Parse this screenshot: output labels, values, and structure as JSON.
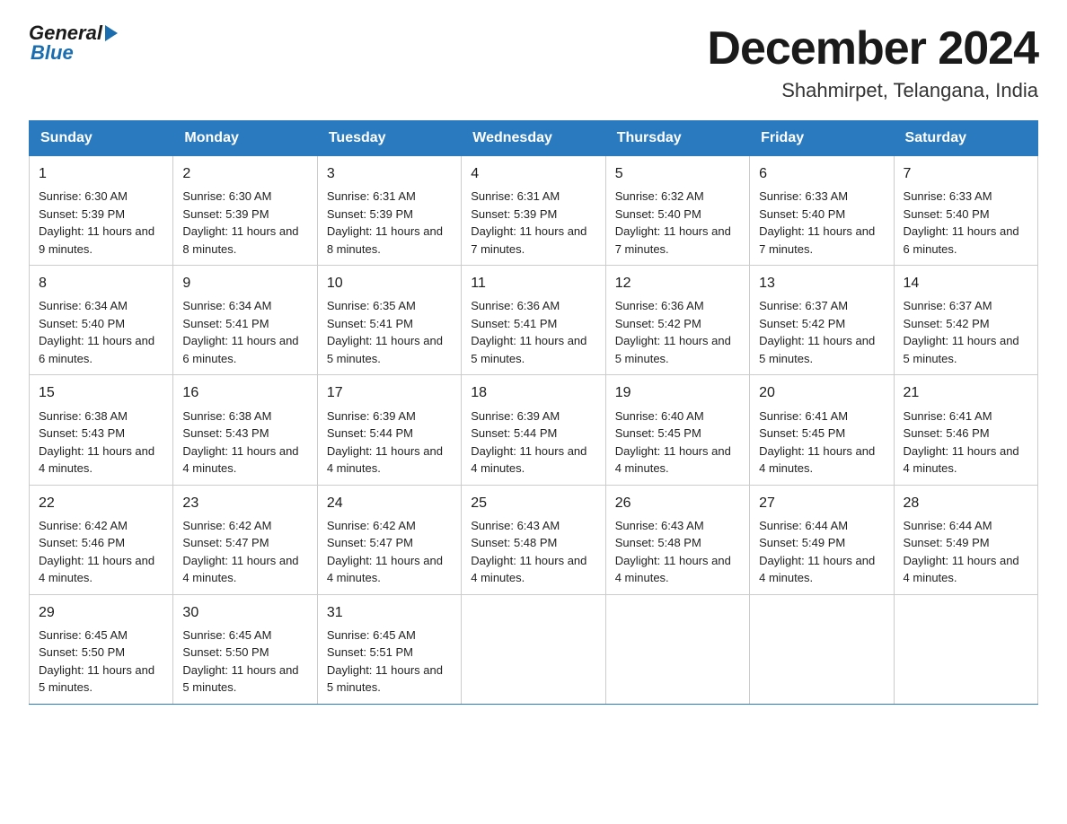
{
  "logo": {
    "general": "General",
    "blue": "Blue"
  },
  "title": "December 2024",
  "subtitle": "Shahmirpet, Telangana, India",
  "days_of_week": [
    "Sunday",
    "Monday",
    "Tuesday",
    "Wednesday",
    "Thursday",
    "Friday",
    "Saturday"
  ],
  "weeks": [
    [
      {
        "day": "1",
        "sunrise": "Sunrise: 6:30 AM",
        "sunset": "Sunset: 5:39 PM",
        "daylight": "Daylight: 11 hours and 9 minutes."
      },
      {
        "day": "2",
        "sunrise": "Sunrise: 6:30 AM",
        "sunset": "Sunset: 5:39 PM",
        "daylight": "Daylight: 11 hours and 8 minutes."
      },
      {
        "day": "3",
        "sunrise": "Sunrise: 6:31 AM",
        "sunset": "Sunset: 5:39 PM",
        "daylight": "Daylight: 11 hours and 8 minutes."
      },
      {
        "day": "4",
        "sunrise": "Sunrise: 6:31 AM",
        "sunset": "Sunset: 5:39 PM",
        "daylight": "Daylight: 11 hours and 7 minutes."
      },
      {
        "day": "5",
        "sunrise": "Sunrise: 6:32 AM",
        "sunset": "Sunset: 5:40 PM",
        "daylight": "Daylight: 11 hours and 7 minutes."
      },
      {
        "day": "6",
        "sunrise": "Sunrise: 6:33 AM",
        "sunset": "Sunset: 5:40 PM",
        "daylight": "Daylight: 11 hours and 7 minutes."
      },
      {
        "day": "7",
        "sunrise": "Sunrise: 6:33 AM",
        "sunset": "Sunset: 5:40 PM",
        "daylight": "Daylight: 11 hours and 6 minutes."
      }
    ],
    [
      {
        "day": "8",
        "sunrise": "Sunrise: 6:34 AM",
        "sunset": "Sunset: 5:40 PM",
        "daylight": "Daylight: 11 hours and 6 minutes."
      },
      {
        "day": "9",
        "sunrise": "Sunrise: 6:34 AM",
        "sunset": "Sunset: 5:41 PM",
        "daylight": "Daylight: 11 hours and 6 minutes."
      },
      {
        "day": "10",
        "sunrise": "Sunrise: 6:35 AM",
        "sunset": "Sunset: 5:41 PM",
        "daylight": "Daylight: 11 hours and 5 minutes."
      },
      {
        "day": "11",
        "sunrise": "Sunrise: 6:36 AM",
        "sunset": "Sunset: 5:41 PM",
        "daylight": "Daylight: 11 hours and 5 minutes."
      },
      {
        "day": "12",
        "sunrise": "Sunrise: 6:36 AM",
        "sunset": "Sunset: 5:42 PM",
        "daylight": "Daylight: 11 hours and 5 minutes."
      },
      {
        "day": "13",
        "sunrise": "Sunrise: 6:37 AM",
        "sunset": "Sunset: 5:42 PM",
        "daylight": "Daylight: 11 hours and 5 minutes."
      },
      {
        "day": "14",
        "sunrise": "Sunrise: 6:37 AM",
        "sunset": "Sunset: 5:42 PM",
        "daylight": "Daylight: 11 hours and 5 minutes."
      }
    ],
    [
      {
        "day": "15",
        "sunrise": "Sunrise: 6:38 AM",
        "sunset": "Sunset: 5:43 PM",
        "daylight": "Daylight: 11 hours and 4 minutes."
      },
      {
        "day": "16",
        "sunrise": "Sunrise: 6:38 AM",
        "sunset": "Sunset: 5:43 PM",
        "daylight": "Daylight: 11 hours and 4 minutes."
      },
      {
        "day": "17",
        "sunrise": "Sunrise: 6:39 AM",
        "sunset": "Sunset: 5:44 PM",
        "daylight": "Daylight: 11 hours and 4 minutes."
      },
      {
        "day": "18",
        "sunrise": "Sunrise: 6:39 AM",
        "sunset": "Sunset: 5:44 PM",
        "daylight": "Daylight: 11 hours and 4 minutes."
      },
      {
        "day": "19",
        "sunrise": "Sunrise: 6:40 AM",
        "sunset": "Sunset: 5:45 PM",
        "daylight": "Daylight: 11 hours and 4 minutes."
      },
      {
        "day": "20",
        "sunrise": "Sunrise: 6:41 AM",
        "sunset": "Sunset: 5:45 PM",
        "daylight": "Daylight: 11 hours and 4 minutes."
      },
      {
        "day": "21",
        "sunrise": "Sunrise: 6:41 AM",
        "sunset": "Sunset: 5:46 PM",
        "daylight": "Daylight: 11 hours and 4 minutes."
      }
    ],
    [
      {
        "day": "22",
        "sunrise": "Sunrise: 6:42 AM",
        "sunset": "Sunset: 5:46 PM",
        "daylight": "Daylight: 11 hours and 4 minutes."
      },
      {
        "day": "23",
        "sunrise": "Sunrise: 6:42 AM",
        "sunset": "Sunset: 5:47 PM",
        "daylight": "Daylight: 11 hours and 4 minutes."
      },
      {
        "day": "24",
        "sunrise": "Sunrise: 6:42 AM",
        "sunset": "Sunset: 5:47 PM",
        "daylight": "Daylight: 11 hours and 4 minutes."
      },
      {
        "day": "25",
        "sunrise": "Sunrise: 6:43 AM",
        "sunset": "Sunset: 5:48 PM",
        "daylight": "Daylight: 11 hours and 4 minutes."
      },
      {
        "day": "26",
        "sunrise": "Sunrise: 6:43 AM",
        "sunset": "Sunset: 5:48 PM",
        "daylight": "Daylight: 11 hours and 4 minutes."
      },
      {
        "day": "27",
        "sunrise": "Sunrise: 6:44 AM",
        "sunset": "Sunset: 5:49 PM",
        "daylight": "Daylight: 11 hours and 4 minutes."
      },
      {
        "day": "28",
        "sunrise": "Sunrise: 6:44 AM",
        "sunset": "Sunset: 5:49 PM",
        "daylight": "Daylight: 11 hours and 4 minutes."
      }
    ],
    [
      {
        "day": "29",
        "sunrise": "Sunrise: 6:45 AM",
        "sunset": "Sunset: 5:50 PM",
        "daylight": "Daylight: 11 hours and 5 minutes."
      },
      {
        "day": "30",
        "sunrise": "Sunrise: 6:45 AM",
        "sunset": "Sunset: 5:50 PM",
        "daylight": "Daylight: 11 hours and 5 minutes."
      },
      {
        "day": "31",
        "sunrise": "Sunrise: 6:45 AM",
        "sunset": "Sunset: 5:51 PM",
        "daylight": "Daylight: 11 hours and 5 minutes."
      },
      null,
      null,
      null,
      null
    ]
  ]
}
